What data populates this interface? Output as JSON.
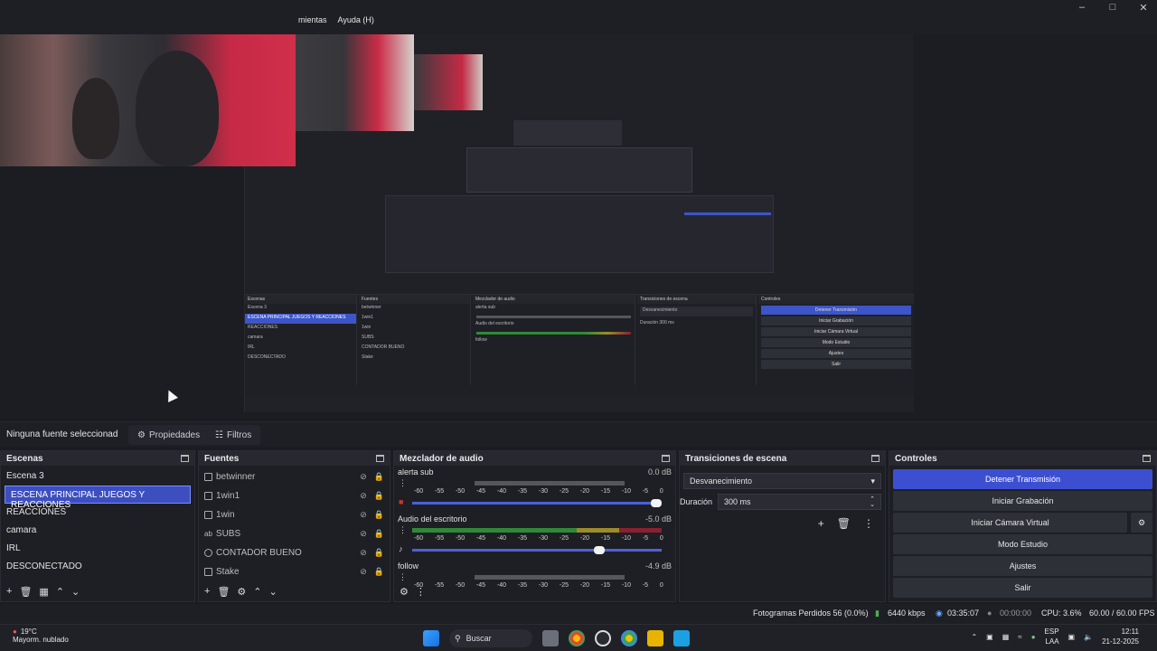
{
  "menu": {
    "items": [
      "mientas",
      "Ayuda (H)"
    ]
  },
  "window_controls": [
    "minimize",
    "maximize",
    "close"
  ],
  "source_toolbar": {
    "no_source": "Ninguna fuente seleccionad",
    "properties": "Propiedades",
    "filters": "Filtros"
  },
  "scenes": {
    "title": "Escenas",
    "items": [
      "Escena 3",
      "ESCENA PRINCIPAL JUEGOS Y REACCIONES",
      "REACCIONES",
      "camara",
      "IRL",
      "DESCONECTADO"
    ],
    "selected_index": 1
  },
  "sources": {
    "title": "Fuentes",
    "items": [
      {
        "label": "betwinner",
        "icon": "image-icon"
      },
      {
        "label": "1win1",
        "icon": "image-icon"
      },
      {
        "label": "1win",
        "icon": "image-icon"
      },
      {
        "label": "SUBS",
        "icon": "text-icon"
      },
      {
        "label": "CONTADOR BUENO",
        "icon": "browser-icon"
      },
      {
        "label": "Stake",
        "icon": "image-icon"
      }
    ]
  },
  "mixer": {
    "title": "Mezclador de audio",
    "scale": [
      "-60",
      "-55",
      "-50",
      "-45",
      "-40",
      "-35",
      "-30",
      "-25",
      "-20",
      "-15",
      "-10",
      "-5",
      "0"
    ],
    "channels": [
      {
        "name": "alerta sub",
        "db": "0.0 dB",
        "level": 0.0,
        "volume": 1.0,
        "muted": true
      },
      {
        "name": "Audio del escritorio",
        "db": "-5.0 dB",
        "level": 1.0,
        "volume": 0.77,
        "muted": false
      },
      {
        "name": "follow",
        "db": "-4.9 dB",
        "level": 0.0,
        "volume": 0.77,
        "muted": false
      }
    ]
  },
  "transitions": {
    "title": "Transiciones de escena",
    "current": "Desvanecimiento",
    "duration_label": "Duración",
    "duration_value": "300 ms"
  },
  "controls": {
    "title": "Controles",
    "buttons": [
      "Detener Transmisión",
      "Iniciar Grabación",
      "Iniciar Cámara Virtual",
      "Modo Estudio",
      "Ajustes",
      "Salir"
    ]
  },
  "status": {
    "dropped": "Fotogramas Perdidos 56 (0.0%)",
    "bitrate": "6440 kbps",
    "stream_time": "03:35:07",
    "rec_time": "00:00:00",
    "cpu": "CPU: 3.6%",
    "fps": "60.00 / 60.00 FPS"
  },
  "taskbar": {
    "temp": "19°C",
    "weather": "Mayorm. nublado",
    "search": "Buscar",
    "lang": "ESP",
    "lang2": "LAA",
    "time": "12:11",
    "date": "21-12-2025"
  },
  "colors": {
    "accent": "#3d4fd1",
    "bg": "#1e1f25",
    "meter_green": "#2f8a36",
    "meter_red": "#8a2030"
  }
}
